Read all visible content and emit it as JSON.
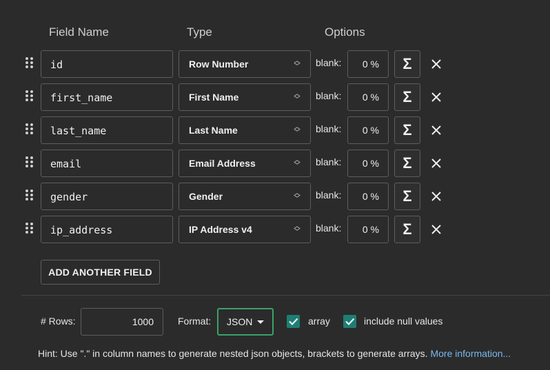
{
  "headers": {
    "field_name": "Field Name",
    "type": "Type",
    "options": "Options"
  },
  "fields": [
    {
      "name": "id",
      "type": "Row Number",
      "blank_label": "blank:",
      "blank_value": "0 %"
    },
    {
      "name": "first_name",
      "type": "First Name",
      "blank_label": "blank:",
      "blank_value": "0 %"
    },
    {
      "name": "last_name",
      "type": "Last Name",
      "blank_label": "blank:",
      "blank_value": "0 %"
    },
    {
      "name": "email",
      "type": "Email Address",
      "blank_label": "blank:",
      "blank_value": "0 %"
    },
    {
      "name": "gender",
      "type": "Gender",
      "blank_label": "blank:",
      "blank_value": "0 %"
    },
    {
      "name": "ip_address",
      "type": "IP Address v4",
      "blank_label": "blank:",
      "blank_value": "0 %"
    }
  ],
  "add_field_label": "ADD ANOTHER FIELD",
  "settings": {
    "rows_label": "# Rows:",
    "rows_value": "1000",
    "format_label": "Format:",
    "format_value": "JSON",
    "array_label": "array",
    "array_checked": true,
    "null_label": "include null values",
    "null_checked": true
  },
  "hint": {
    "text": "Hint: Use \".\" in column names to generate nested json objects, brackets to generate arrays.",
    "link": "More information..."
  },
  "colors": {
    "background": "#2b2b2b",
    "accent_green": "#3aa26a",
    "checkbox_teal": "#1f7d74",
    "link_blue": "#79b8ef"
  },
  "icons": {
    "drag": "drag-handle-icon",
    "type_select": "up-down-chevron-icon",
    "formula": "sigma-icon",
    "remove": "close-icon",
    "format_dropdown": "caret-down-icon",
    "checkbox": "checkmark-icon"
  }
}
